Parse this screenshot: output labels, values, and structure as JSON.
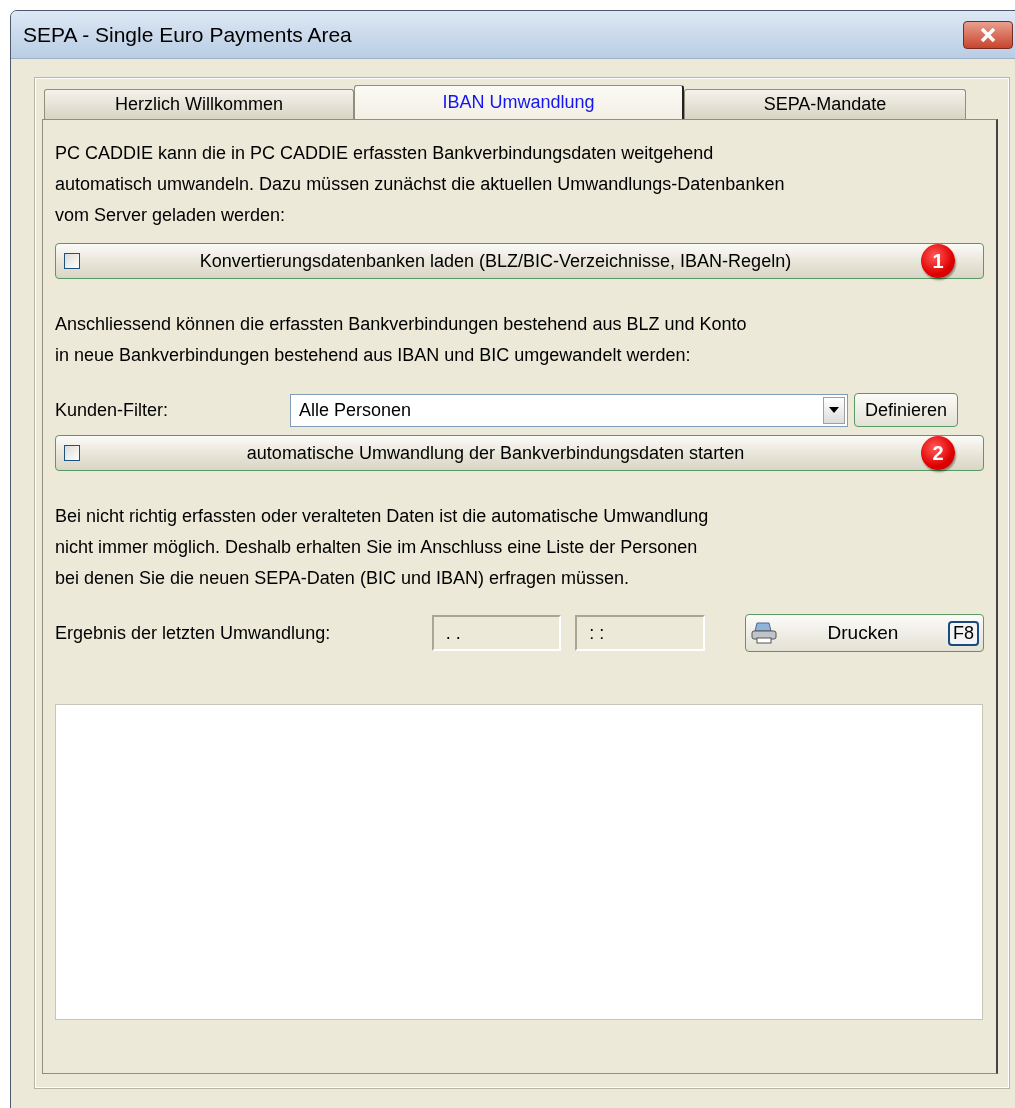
{
  "window": {
    "title": "SEPA - Single Euro Payments Area"
  },
  "tabs": [
    {
      "label": "Herzlich Willkommen",
      "selected": false
    },
    {
      "label": "IBAN Umwandlung",
      "selected": true
    },
    {
      "label": "SEPA-Mandate",
      "selected": false
    }
  ],
  "intro": "PC CADDIE kann die in PC CADDIE erfassten Bankverbindungsdaten weitgehend\nautomatisch umwandeln. Dazu müssen zunächst die aktuellen Umwandlungs-Datenbanken\nvom Server geladen werden:",
  "load_button": {
    "label": "Konvertierungsdatenbanken laden (BLZ/BIC-Verzeichnisse, IBAN-Regeln)",
    "checked": false,
    "badge": "1"
  },
  "conversion_text": "Anschliessend können die erfassten Bankverbindungen bestehend aus BLZ und Konto\nin neue Bankverbindungen bestehend aus IBAN und BIC umgewandelt werden:",
  "filter": {
    "label": "Kunden-Filter:",
    "value": "Alle Personen",
    "button": "Definieren"
  },
  "start_button": {
    "label": "automatische Umwandlung der Bankverbindungsdaten starten",
    "checked": false,
    "badge": "2"
  },
  "note": "Bei nicht richtig erfassten oder veralteten Daten ist die automatische Umwandlung\nnicht immer möglich. Deshalb erhalten Sie im Anschluss eine Liste der Personen\nbei denen Sie die neuen SEPA-Daten (BIC und IBAN) erfragen müssen.",
  "result": {
    "label": "Ergebnis der letzten Umwandlung:",
    "date": ". .",
    "time": ": :",
    "print_button": "Drucken",
    "shortcut": "F8"
  }
}
